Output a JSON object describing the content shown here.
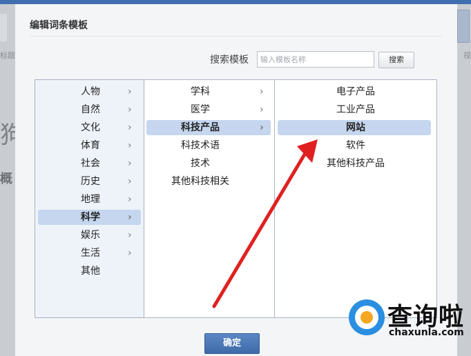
{
  "background": {
    "left_text": "标题",
    "left_big": "狗",
    "left_mid": "概",
    "right_text": "视"
  },
  "modal": {
    "title": "编辑词条模板",
    "search": {
      "label": "搜索模板",
      "placeholder": "输入模板名称",
      "button": "搜索"
    },
    "column1": {
      "items": [
        {
          "label": "人物",
          "has_children": true,
          "selected": false
        },
        {
          "label": "自然",
          "has_children": true,
          "selected": false
        },
        {
          "label": "文化",
          "has_children": true,
          "selected": false
        },
        {
          "label": "体育",
          "has_children": true,
          "selected": false
        },
        {
          "label": "社会",
          "has_children": true,
          "selected": false
        },
        {
          "label": "历史",
          "has_children": true,
          "selected": false
        },
        {
          "label": "地理",
          "has_children": true,
          "selected": false
        },
        {
          "label": "科学",
          "has_children": true,
          "selected": true
        },
        {
          "label": "娱乐",
          "has_children": true,
          "selected": false
        },
        {
          "label": "生活",
          "has_children": true,
          "selected": false
        },
        {
          "label": "其他",
          "has_children": false,
          "selected": false
        }
      ]
    },
    "column2": {
      "items": [
        {
          "label": "学科",
          "has_children": true,
          "selected": false
        },
        {
          "label": "医学",
          "has_children": true,
          "selected": false
        },
        {
          "label": "科技产品",
          "has_children": true,
          "selected": true
        },
        {
          "label": "科技术语",
          "has_children": false,
          "selected": false
        },
        {
          "label": "技术",
          "has_children": false,
          "selected": false
        },
        {
          "label": "其他科技相关",
          "has_children": false,
          "selected": false
        }
      ]
    },
    "column3": {
      "items": [
        {
          "label": "电子产品",
          "selected": false
        },
        {
          "label": "工业产品",
          "selected": false
        },
        {
          "label": "网站",
          "selected": true
        },
        {
          "label": "软件",
          "selected": false
        },
        {
          "label": "其他科技产品",
          "selected": false
        }
      ]
    },
    "confirm_button": "确定"
  },
  "arrow_glyph": "›",
  "annotation": {
    "color": "#e02020"
  },
  "watermark": {
    "cn": "查询啦",
    "en": "chaxunla.com",
    "colors": {
      "ring": "#2a8fe0",
      "dot": "#f5a623"
    }
  }
}
